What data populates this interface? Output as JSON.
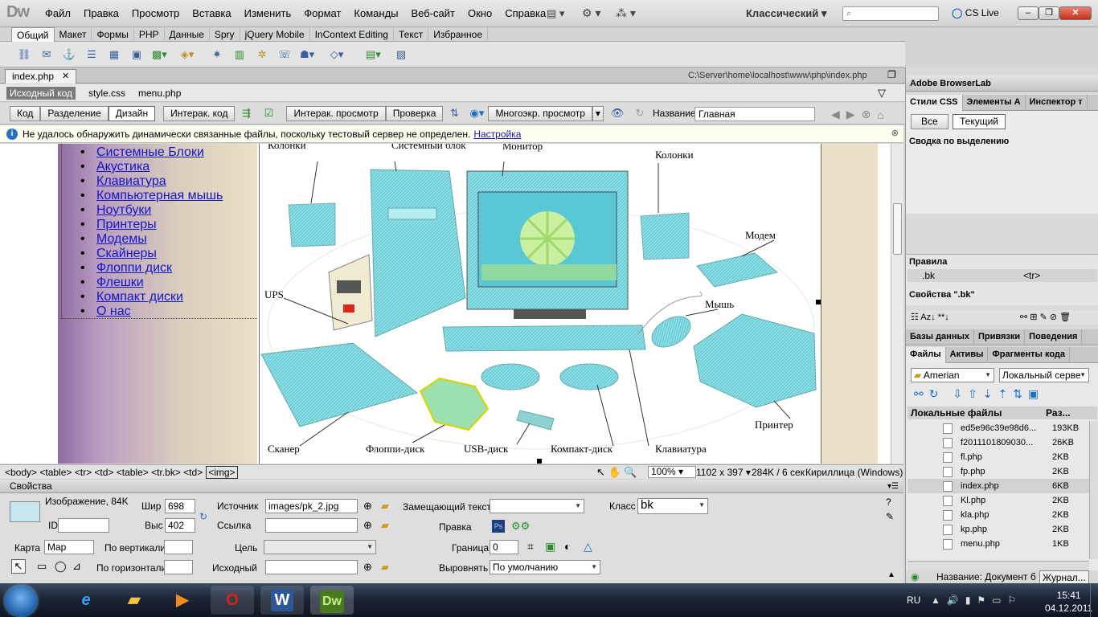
{
  "app": {
    "logo": "Dw",
    "menu": [
      "Файл",
      "Правка",
      "Просмотр",
      "Вставка",
      "Изменить",
      "Формат",
      "Команды",
      "Веб-сайт",
      "Окно",
      "Справка"
    ],
    "workspace": "Классический",
    "cslive": "CS Live"
  },
  "insert_tabs": [
    "Общий",
    "Макет",
    "Формы",
    "PHP",
    "Данные",
    "Spry",
    "jQuery Mobile",
    "InContext Editing",
    "Текст",
    "Избранное"
  ],
  "document": {
    "tab": "index.php",
    "path": "C:\\Server\\home\\localhost\\www\\php\\index.php",
    "related": [
      "Исходный код",
      "style.css",
      "menu.php"
    ],
    "views": [
      "Код",
      "Разделение",
      "Дизайн"
    ],
    "live_code": "Интерак. код",
    "live_view": "Интерак. просмотр",
    "check": "Проверка",
    "multiscreen": "Многоэкр. просмотр",
    "title_label": "Название:",
    "title_value": "Главная",
    "info": "Не удалось обнаружить динамически связанные файлы, поскольку тестовый сервер не определен.",
    "info_link": "Настройка"
  },
  "nav": [
    "Системные Блоки",
    "Акустика",
    "Клавиатура",
    "Компьютерная мышь",
    "Ноутбуки",
    "Принтеры",
    "Модемы",
    "Скайнеры",
    "Флоппи диск",
    "Флешки",
    "Компакт диски",
    "О нас"
  ],
  "diagram_labels": {
    "speakers_left": "Колонки",
    "system_unit": "Системный блок",
    "monitor": "Монитор",
    "speakers_right": "Колонки",
    "modem": "Модем",
    "ups": "UPS",
    "mouse": "Мышь",
    "scanner": "Сканер",
    "floppy": "Флоппи-диск",
    "usb": "USB-диск",
    "cd": "Компакт-диск",
    "keyboard": "Клавиатура",
    "printer": "Принтер"
  },
  "status": {
    "tags": "<body> <table> <tr> <td> <table> <tr.bk> <td>",
    "selected_tag": "<img>",
    "zoom": "100%",
    "size": "1102 x 397",
    "weight": "284K / 6 сек",
    "encoding": "Кириллица (Windows)"
  },
  "props": {
    "header": "Свойства",
    "kind": "Изображение, 84K",
    "id_label": "ID",
    "w_label": "Шир",
    "w": "698",
    "h_label": "Выс",
    "h": "402",
    "src_label": "Источник",
    "src": "images/pk_2.jpg",
    "link_label": "Ссылка",
    "alt_label": "Замещающий текст",
    "edit_label": "Правка",
    "class_label": "Класс",
    "class_value": "bk",
    "map_label": "Карта",
    "map_value": "Map",
    "vspace_label": "По вертикали",
    "hspace_label": "По горизонтали",
    "target_label": "Цель",
    "orig_label": "Исходный",
    "border_label": "Граница",
    "border_value": "0",
    "align_label": "Выровнять",
    "align_value": "По умолчанию"
  },
  "rpanel": {
    "browserlab": "Adobe BrowserLab",
    "css_tabs": [
      "Стили CSS",
      "Элементы A",
      "Инспектор т"
    ],
    "all": "Все",
    "current": "Текущий",
    "summary": "Сводка по выделению",
    "rules": "Правила",
    "rule_sel": ".bk",
    "rule_tag": "<tr>",
    "props_of": "Свойства \".bk\"",
    "data_tabs": [
      "Базы данных",
      "Привязки",
      "Поведения"
    ],
    "file_tabs": [
      "Файлы",
      "Активы",
      "Фрагменты кода"
    ],
    "site": "Amerian",
    "view": "Локальный серве",
    "col_name": "Локальные файлы",
    "col_size": "Раз...",
    "files": [
      {
        "name": "ed5e96c39e98d6...",
        "size": "193KB"
      },
      {
        "name": "f2011101809030...",
        "size": "26KB"
      },
      {
        "name": "fl.php",
        "size": "2KB"
      },
      {
        "name": "fp.php",
        "size": "2KB"
      },
      {
        "name": "index.php",
        "size": "6KB"
      },
      {
        "name": "Kl.php",
        "size": "2KB"
      },
      {
        "name": "kla.php",
        "size": "2KB"
      },
      {
        "name": "kp.php",
        "size": "2KB"
      },
      {
        "name": "menu.php",
        "size": "1KB"
      }
    ],
    "bottom_title": "Название: Документ б",
    "journal": "Журнал..."
  },
  "taskbar": {
    "lang": "RU",
    "time": "15:41",
    "date": "04.12.2011",
    "word": "W",
    "dw": "Dw"
  }
}
